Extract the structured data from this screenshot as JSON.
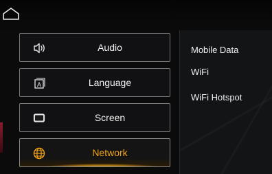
{
  "header": {
    "home_icon": "home-icon"
  },
  "menu": {
    "items": [
      {
        "label": "Audio",
        "icon": "speaker-icon"
      },
      {
        "label": "Language",
        "icon": "language-icon"
      },
      {
        "label": "Screen",
        "icon": "screen-icon"
      },
      {
        "label": "Network",
        "icon": "globe-icon",
        "active": true
      }
    ]
  },
  "panel": {
    "items": [
      {
        "label": "Mobile Data"
      },
      {
        "label": "WiFi"
      },
      {
        "label": "WiFi Hotspot"
      }
    ]
  },
  "colors": {
    "background": "#0b0b0c",
    "accent": "#f0a417",
    "border": "#7a7a7a",
    "edge_accent": "#8a1b2e"
  }
}
